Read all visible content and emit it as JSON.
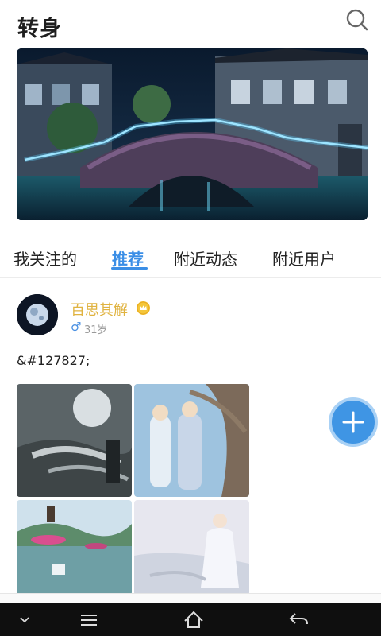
{
  "app": {
    "title": "转身"
  },
  "header": {
    "search_icon": "search-icon"
  },
  "banner": {
    "alt": "night canal bridge scene"
  },
  "tabs": [
    {
      "label": "我关注的",
      "active": false
    },
    {
      "label": "推荐",
      "active": true
    },
    {
      "label": "附近动态",
      "active": false
    },
    {
      "label": "附近用户",
      "active": false
    }
  ],
  "post": {
    "username": "百思其解",
    "gender_symbol": "♂",
    "age": "31岁",
    "text": "&#127827;",
    "badge_icon": "crown-icon"
  },
  "fab": {
    "icon": "plus-icon"
  },
  "navbar": {
    "icons": [
      "chevron-down-icon",
      "menu-icon",
      "home-icon",
      "back-icon"
    ]
  },
  "colors": {
    "accent": "#3a8ee6",
    "username": "#e0b340",
    "fab": "#3f95e4",
    "navbar": "#0f0f0f"
  }
}
